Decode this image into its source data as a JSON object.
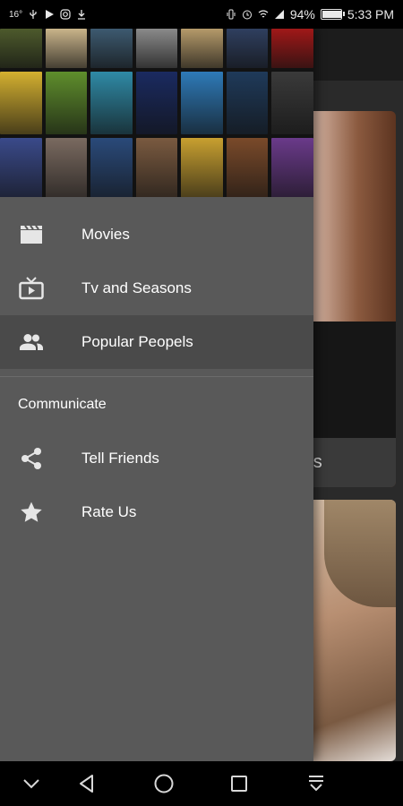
{
  "status_bar": {
    "temperature": "16°",
    "battery_percent": "94%",
    "battery_level": 0.94,
    "time": "5:33 PM",
    "left_icons": [
      "usb-icon",
      "play-icon",
      "instagram-icon",
      "download-icon"
    ],
    "right_icons": [
      "vibrate-icon",
      "alarm-icon",
      "wifi-icon",
      "signal-icon",
      "battery-icon"
    ]
  },
  "background": {
    "card_label_partial": "rcos"
  },
  "drawer": {
    "poster_colors": [
      "#4d5a2c",
      "#c9b48a",
      "#3d5a70",
      "#8a8a8a",
      "#b59a6a",
      "#2f3f5f",
      "#a01818",
      "#d4b030",
      "#5f8e2c",
      "#2f8aa6",
      "#1a2a60",
      "#2e7ab8",
      "#1f3a5a",
      "#3a3a3a",
      "#3a4a8a",
      "#7a6a60",
      "#2a4a7a",
      "#7a5a40",
      "#c8a030",
      "#7a4a2a",
      "#6a3a8a"
    ],
    "menu": [
      {
        "label": "Movies",
        "icon": "movie-clapper-icon",
        "active": false
      },
      {
        "label": "Tv and Seasons",
        "icon": "tv-icon",
        "active": false
      },
      {
        "label": "Popular Peopels",
        "icon": "people-icon",
        "active": true
      }
    ],
    "section_title": "Communicate",
    "communicate": [
      {
        "label": "Tell Friends",
        "icon": "share-icon"
      },
      {
        "label": "Rate Us",
        "icon": "star-icon"
      }
    ]
  },
  "nav_bar": {
    "buttons": [
      "chevron-down-icon",
      "back-icon",
      "home-icon",
      "recents-icon",
      "notification-pull-icon"
    ]
  }
}
